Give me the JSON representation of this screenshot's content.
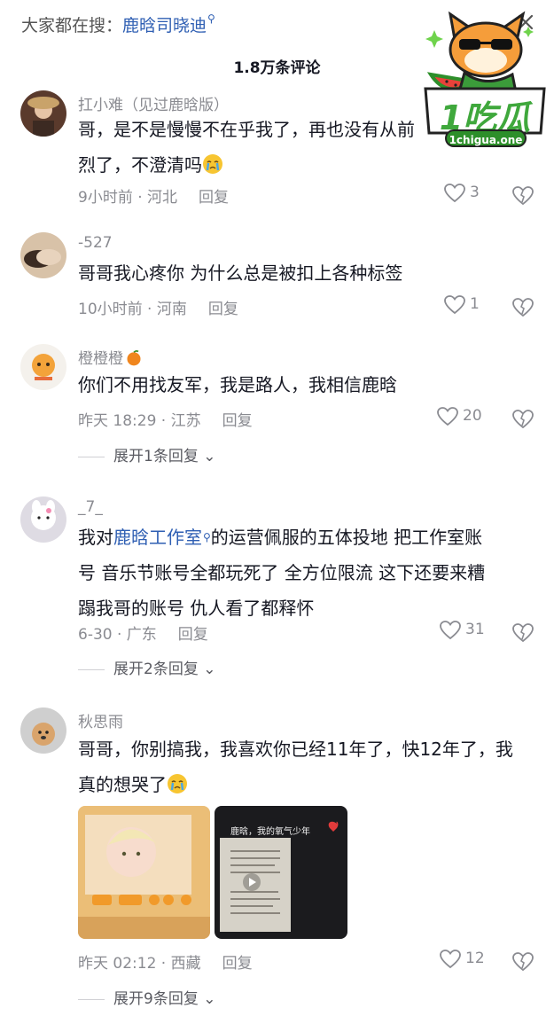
{
  "search": {
    "prefix": "大家都在搜：",
    "keyword": "鹿晗司晓迪"
  },
  "watermark": {
    "brand": "1吃瓜",
    "url": "1chigua.one"
  },
  "comment_count": "1.8万条评论",
  "comments": [
    {
      "username": "扛小难（见过鹿晗版）",
      "text_line1": "哥，是不是慢慢不在乎我了，再也没有从前",
      "text_line2": "烈了，不澄清吗",
      "time_location": "9小时前 · 河北",
      "reply_label": "回复",
      "likes": "3"
    },
    {
      "username": "-527",
      "text_line1": "哥哥我心疼你 为什么总是被扣上各种标签",
      "time_location": "10小时前 · 河南",
      "reply_label": "回复",
      "likes": "1"
    },
    {
      "username": "橙橙橙",
      "text_line1": "你们不用找友军，我是路人，我相信鹿晗",
      "time_location": "昨天 18:29 · 江苏",
      "reply_label": "回复",
      "likes": "20",
      "expand": "展开1条回复"
    },
    {
      "username": "_7_",
      "text_prefix": "我对",
      "text_link": "鹿晗工作室",
      "text_rest": "的运营佩服的五体投地  把工作室账",
      "text_line2": "号  音乐节账号全都玩死了  全方位限流  这下还要来糟",
      "text_line3": "蹋我哥的账号  仇人看了都释怀",
      "time_location": "6-30 · 广东",
      "reply_label": "回复",
      "likes": "31",
      "expand": "展开2条回复"
    },
    {
      "username": "秋思雨",
      "text_line1": "哥哥，你别搞我，我喜欢你已经11年了，快12年了，我",
      "text_line2": "真的想哭了",
      "image2_caption": "鹿晗，我的氧气少年",
      "time_location": "昨天 02:12 · 西藏",
      "reply_label": "回复",
      "likes": "12",
      "expand": "展开9条回复"
    }
  ],
  "colors": {
    "link": "#2f5fb3",
    "meta": "#8a8b91",
    "text": "#161823"
  }
}
